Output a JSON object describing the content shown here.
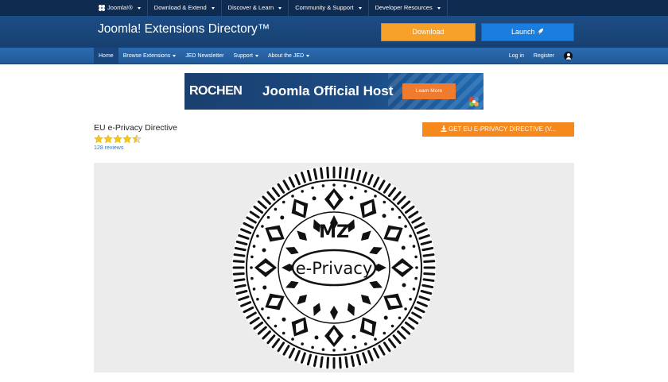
{
  "topbar": {
    "items": [
      {
        "label": "Joomla!®",
        "icon": "joomla-logo-icon"
      },
      {
        "label": "Download & Extend"
      },
      {
        "label": "Discover & Learn"
      },
      {
        "label": "Community & Support"
      },
      {
        "label": "Developer Resources"
      }
    ]
  },
  "header": {
    "title": "Joomla! Extensions Directory™",
    "download_label": "Download",
    "launch_label": "Launch",
    "launch_icon": "rocket-icon",
    "colors": {
      "download": "#f7a12a",
      "launch": "#1a7ee0"
    }
  },
  "nav": {
    "items": [
      {
        "label": "Home",
        "active": true
      },
      {
        "label": "Browse Extensions",
        "dropdown": true
      },
      {
        "label": "JED Newsletter"
      },
      {
        "label": "Support",
        "dropdown": true
      },
      {
        "label": "About the JED",
        "dropdown": true
      }
    ],
    "login_label": "Log in",
    "register_label": "Register",
    "user_icon": "user-icon"
  },
  "banner": {
    "brand": "ROCHEN",
    "headline": "Joomla Official Host",
    "cta": "Learn More"
  },
  "extension": {
    "title": "EU e-Privacy Directive",
    "rating": 4.5,
    "max_rating": 5,
    "reviews": "128 reviews",
    "get_button": "GET EU E-PRIVACY DIRECTIVE (V...",
    "image_text": "e-Privacy",
    "image_mark": "MZ"
  }
}
